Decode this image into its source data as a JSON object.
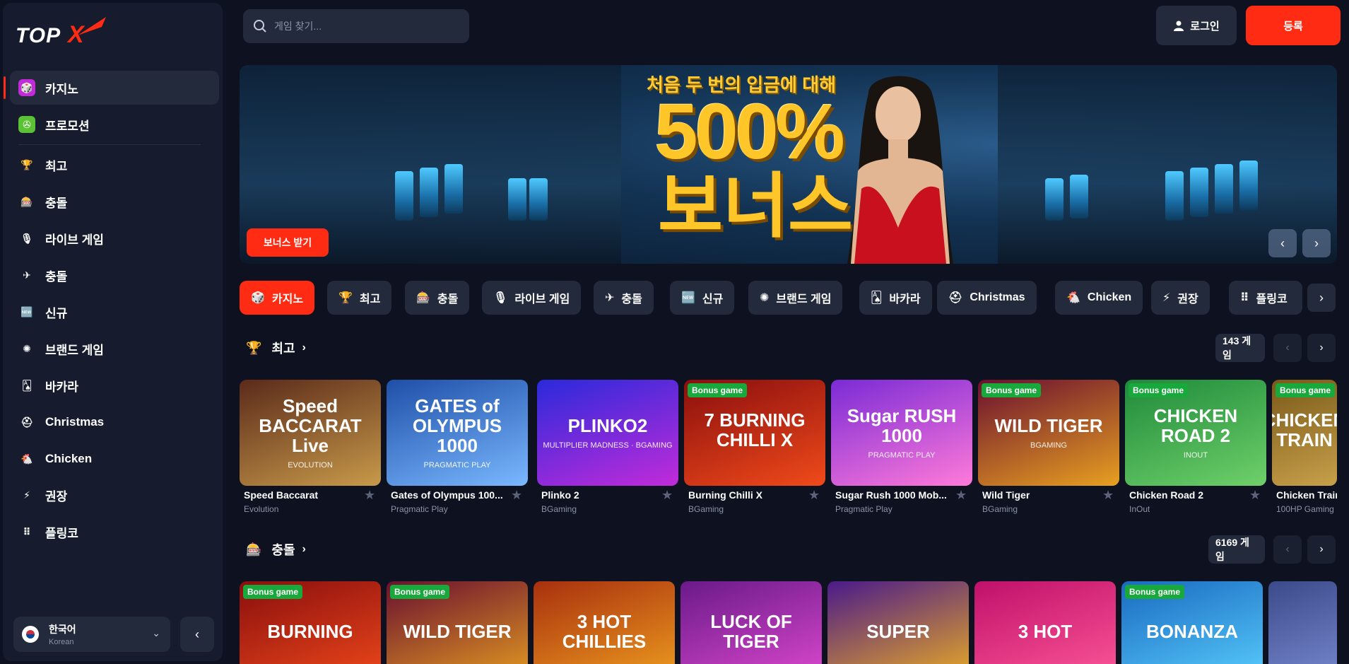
{
  "brand": {
    "logo_text": "TOPX",
    "accent": "#ff2b12"
  },
  "sidebar": {
    "items": [
      {
        "label": "카지노",
        "icon": "casino-icon",
        "active": true
      },
      {
        "label": "프로모션",
        "icon": "promotion-icon"
      },
      {
        "label": "최고",
        "icon": "trophy-icon"
      },
      {
        "label": "충돌",
        "icon": "slots-icon"
      },
      {
        "label": "라이브 게임",
        "icon": "live-icon"
      },
      {
        "label": "충돌",
        "icon": "crash-icon"
      },
      {
        "label": "신규",
        "icon": "new-icon"
      },
      {
        "label": "브랜드 게임",
        "icon": "brand-icon"
      },
      {
        "label": "바카라",
        "icon": "baccarat-icon"
      },
      {
        "label": "Christmas",
        "icon": "christmas-hat-icon"
      },
      {
        "label": "Chicken",
        "icon": "chicken-icon"
      },
      {
        "label": "권장",
        "icon": "lightning-icon"
      },
      {
        "label": "플링코",
        "icon": "plinko-icon"
      }
    ],
    "language": {
      "name": "한국어",
      "sub": "Korean"
    }
  },
  "header": {
    "search_placeholder": "게임 찾기...",
    "login_label": "로그인",
    "register_label": "등록"
  },
  "banner": {
    "headline": "처음 두 번의 입금에 대해",
    "big_text": "500%",
    "big_text2": "보너스",
    "cta": "보너스 받기"
  },
  "tabs": [
    {
      "label": "카지노",
      "icon": "casino-icon",
      "active": true
    },
    {
      "label": "최고",
      "icon": "trophy-icon"
    },
    {
      "label": "충돌",
      "icon": "slots-icon"
    },
    {
      "label": "라이브 게임",
      "icon": "live-icon"
    },
    {
      "label": "충돌",
      "icon": "crash-icon"
    },
    {
      "label": "신규",
      "icon": "new-icon"
    },
    {
      "label": "브랜드 게임",
      "icon": "brand-icon"
    },
    {
      "label": "바카라",
      "icon": "baccarat-icon"
    },
    {
      "label": "Christmas",
      "icon": "christmas-hat-icon"
    },
    {
      "label": "Chicken",
      "icon": "chicken-icon"
    },
    {
      "label": "권장",
      "icon": "lightning-icon"
    },
    {
      "label": "플링코",
      "icon": "plinko-icon"
    }
  ],
  "sections": [
    {
      "title": "최고",
      "count": "143 게임",
      "games": [
        {
          "name": "Speed Baccarat",
          "provider": "Evolution",
          "bonus": false,
          "art": "Speed BACCARAT Live",
          "art_sub": "EVOLUTION",
          "colors": [
            "#5b2a1a",
            "#c79a4a"
          ]
        },
        {
          "name": "Gates of Olympus 100...",
          "provider": "Pragmatic Play",
          "bonus": false,
          "art": "GATES of OLYMPUS 1000",
          "art_sub": "PRAGMATIC PLAY",
          "colors": [
            "#1e4fa8",
            "#7ab8ff"
          ]
        },
        {
          "name": "Plinko 2",
          "provider": "BGaming",
          "bonus": false,
          "art": "PLINKO2",
          "art_sub": "MULTIPLIER MADNESS · BGAMING",
          "colors": [
            "#2a2adb",
            "#c22bd9"
          ]
        },
        {
          "name": "Burning Chilli X",
          "provider": "BGaming",
          "bonus": true,
          "art": "7 BURNING CHILLI X",
          "art_sub": "",
          "colors": [
            "#8a0e0e",
            "#f04a1a"
          ]
        },
        {
          "name": "Sugar Rush 1000 Mob...",
          "provider": "Pragmatic Play",
          "bonus": false,
          "art": "Sugar RUSH 1000",
          "art_sub": "PRAGMATIC PLAY",
          "colors": [
            "#7a2bd6",
            "#ff7ad9"
          ]
        },
        {
          "name": "Wild Tiger",
          "provider": "BGaming",
          "bonus": true,
          "art": "WILD TIGER",
          "art_sub": "BGAMING",
          "colors": [
            "#6a1030",
            "#e8a020"
          ]
        },
        {
          "name": "Chicken Road 2",
          "provider": "InOut",
          "bonus": true,
          "art": "CHICKEN ROAD 2",
          "art_sub": "INOUT",
          "colors": [
            "#1e8a3a",
            "#6fd06a"
          ]
        },
        {
          "name": "Chicken Train",
          "provider": "100HP Gaming",
          "bonus": true,
          "art": "CHICKEN TRAIN",
          "art_sub": "",
          "colors": [
            "#7a5a1a",
            "#c8a04a"
          ]
        }
      ]
    },
    {
      "title": "충돌",
      "count": "6169 게임",
      "games": [
        {
          "name": "",
          "provider": "",
          "bonus": true,
          "art": "BURNING",
          "art_sub": "",
          "colors": [
            "#8a0e0e",
            "#f04a1a"
          ]
        },
        {
          "name": "",
          "provider": "",
          "bonus": true,
          "art": "WILD TIGER",
          "art_sub": "",
          "colors": [
            "#6a1030",
            "#e8a020"
          ]
        },
        {
          "name": "",
          "provider": "",
          "bonus": false,
          "art": "3 HOT CHILLIES",
          "art_sub": "",
          "colors": [
            "#a8300e",
            "#f0a020"
          ]
        },
        {
          "name": "",
          "provider": "",
          "bonus": false,
          "art": "LUCK OF TIGER",
          "art_sub": "",
          "colors": [
            "#6a1a8a",
            "#e04ad0"
          ]
        },
        {
          "name": "",
          "provider": "",
          "bonus": false,
          "art": "SUPER",
          "art_sub": "",
          "colors": [
            "#4a1a8a",
            "#f0b020"
          ]
        },
        {
          "name": "",
          "provider": "",
          "bonus": false,
          "art": "3 HOT",
          "art_sub": "",
          "colors": [
            "#c0106a",
            "#ff5a9a"
          ]
        },
        {
          "name": "",
          "provider": "",
          "bonus": true,
          "art": "BONANZA",
          "art_sub": "",
          "colors": [
            "#1a6ac0",
            "#5ad0ff"
          ]
        },
        {
          "name": "",
          "provider": "",
          "bonus": false,
          "art": "",
          "art_sub": "",
          "colors": [
            "#3a4a8a",
            "#7a8ad0"
          ]
        }
      ]
    }
  ],
  "bonus_badge": "Bonus game"
}
